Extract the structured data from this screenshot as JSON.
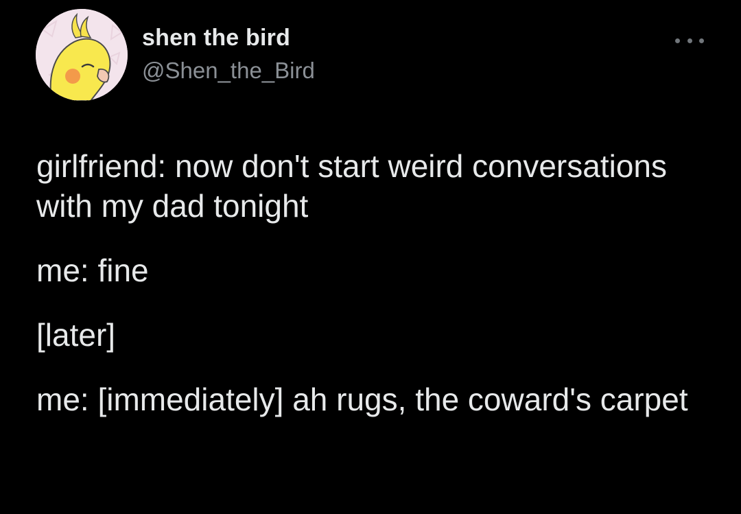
{
  "author": {
    "display_name": "shen the bird",
    "handle": "@Shen_the_Bird",
    "avatar_icon": "cockatiel-avatar-icon"
  },
  "menu": {
    "icon": "more-options-icon"
  },
  "tweet": {
    "paragraphs": [
      "girlfriend: now don't start weird conversations with my dad tonight",
      "me: fine",
      "[later]",
      "me: [immediately] ah rugs, the coward's carpet"
    ]
  },
  "colors": {
    "background": "#000000",
    "primary_text": "#e7e9ea",
    "secondary_text": "#8b9096"
  }
}
